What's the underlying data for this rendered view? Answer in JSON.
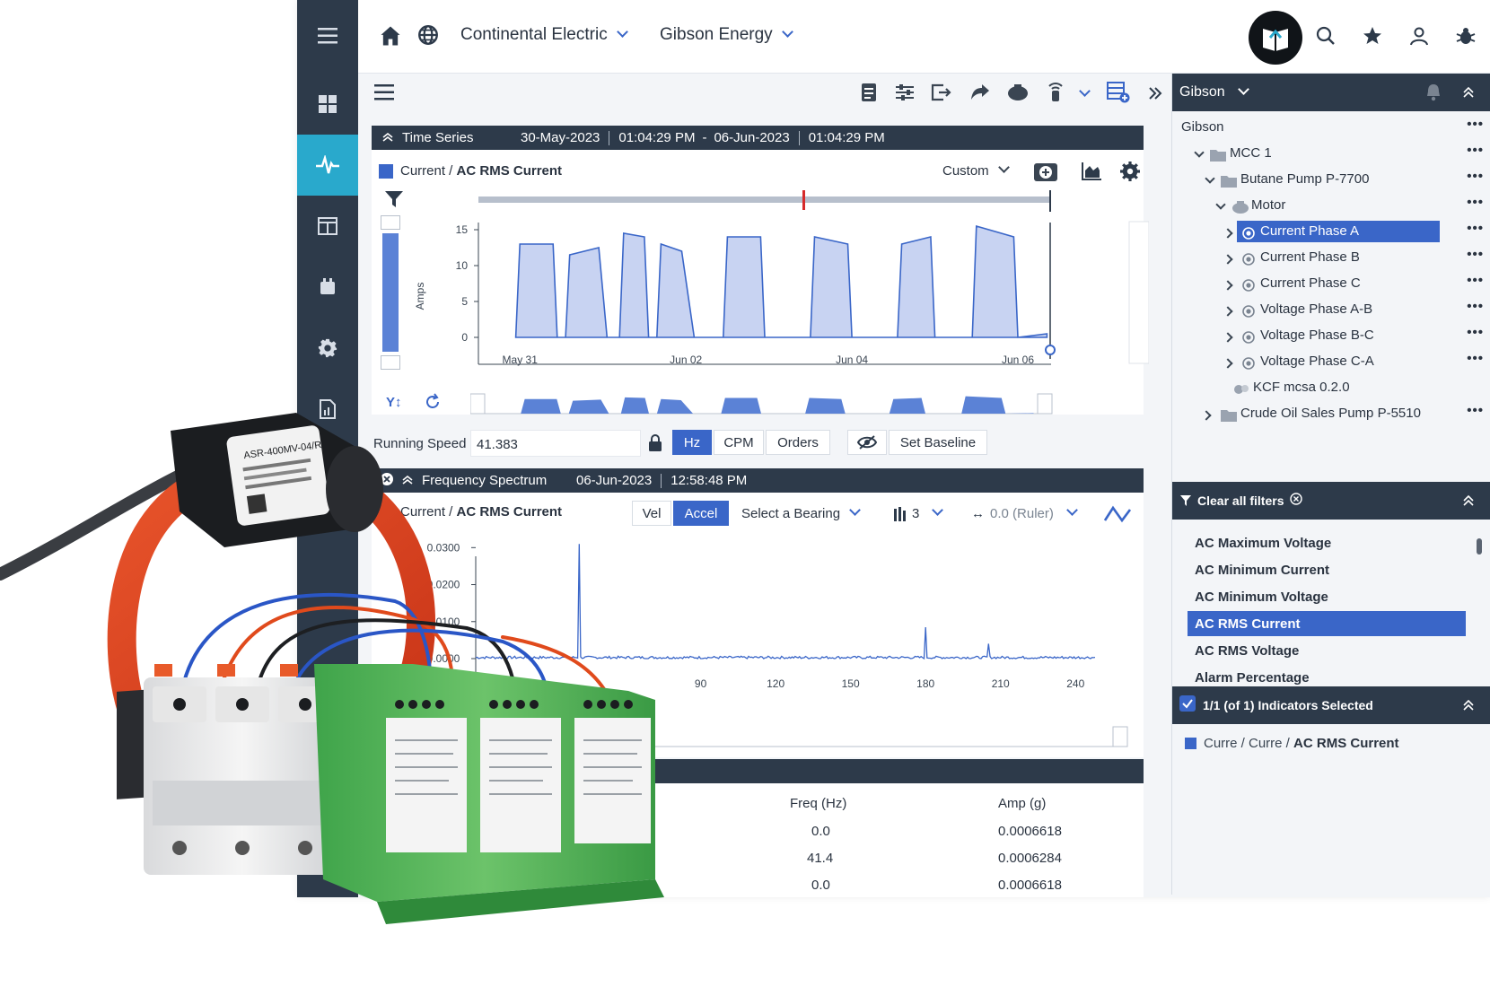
{
  "colors": {
    "rail": "#2d3a4a",
    "rail_active": "#29a9cc",
    "accent": "#3a66c8",
    "header": "#2d3a4a",
    "series_fill": "#c8d3f2",
    "series_stroke": "#3a66c8",
    "red_marker": "#d62b2b"
  },
  "topbar": {
    "breadcrumb_1": "Continental Electric",
    "breadcrumb_2": "Gibson Energy"
  },
  "timeseries": {
    "header_title": "Time Series",
    "start_date": "30-May-2023",
    "start_time": "01:04:29 PM",
    "dash": "-",
    "end_date": "06-Jun-2023",
    "end_time": "01:04:29 PM",
    "series_prefix": "Current / ",
    "series_name": "AC RMS Current",
    "range_select": "Custom",
    "ylabel": "Amps",
    "yticks": [
      "15",
      "10",
      "5",
      "0"
    ],
    "xticks": [
      "May 31",
      "Jun 02",
      "Jun 04",
      "Jun 06"
    ]
  },
  "chart_data": [
    {
      "type": "area",
      "ylabel": "Amps",
      "x_ticks": [
        "May 31",
        "Jun 02",
        "Jun 04",
        "Jun 06"
      ],
      "ylim": [
        0,
        16
      ],
      "series": [
        {
          "name": "AC RMS Current",
          "values_description_free": [
            [
              30.95,
              0
            ],
            [
              31.0,
              13
            ],
            [
              31.4,
              13
            ],
            [
              31.45,
              0
            ],
            [
              31.55,
              0
            ],
            [
              31.6,
              11.5
            ],
            [
              31.95,
              12.5
            ],
            [
              32.05,
              0
            ],
            [
              32.2,
              0
            ],
            [
              32.25,
              14.5
            ],
            [
              32.5,
              14
            ],
            [
              32.55,
              0
            ],
            [
              32.65,
              0
            ],
            [
              32.7,
              13
            ],
            [
              32.95,
              12
            ],
            [
              33.1,
              0
            ],
            [
              33.45,
              0
            ],
            [
              33.5,
              14
            ],
            [
              33.9,
              14
            ],
            [
              33.95,
              0
            ],
            [
              34.5,
              0
            ],
            [
              34.55,
              14
            ],
            [
              34.95,
              13
            ],
            [
              35.0,
              0
            ],
            [
              35.55,
              0
            ],
            [
              35.6,
              13
            ],
            [
              35.95,
              14
            ],
            [
              36.0,
              0
            ],
            [
              36.45,
              0
            ],
            [
              36.5,
              15.5
            ],
            [
              36.95,
              14
            ],
            [
              37.0,
              0
            ],
            [
              37.35,
              0.5
            ]
          ]
        }
      ]
    },
    {
      "type": "line",
      "ylabel": "",
      "xlabel": "",
      "x_ticks": [
        "90",
        "120",
        "150",
        "180",
        "210",
        "240"
      ],
      "y_ticks": [
        "0.0300",
        "0.0200",
        "0.0100",
        "0.0000"
      ],
      "ylim": [
        0,
        0.0325
      ],
      "xlim": [
        0,
        250
      ],
      "series": [
        {
          "name": "AC RMS Current",
          "peaks": [
            {
              "x": 41.4,
              "y": 0.031
            },
            {
              "x": 180,
              "y": 0.0085
            },
            {
              "x": 205,
              "y": 0.004
            }
          ],
          "baseline": 0.0003
        }
      ]
    }
  ],
  "controls": {
    "running_speed_label": "Running Speed",
    "running_speed_value": "41.383",
    "hz": "Hz",
    "cpm": "CPM",
    "orders": "Orders",
    "set_baseline": "Set Baseline"
  },
  "spectrum": {
    "header_title": "Frequency Spectrum",
    "date": "06-Jun-2023",
    "time": "12:58:48 PM",
    "series_prefix": "Current / ",
    "series_name": "AC RMS Current",
    "vel": "Vel",
    "accel": "Accel",
    "bearing": "Select a Bearing",
    "harmonics": "3",
    "ruler": "0.0 (Ruler)",
    "yticks": [
      "0.0300",
      "0.0200",
      "0.0100",
      "0.0000"
    ],
    "xticks": [
      "90",
      "120",
      "150",
      "180",
      "210",
      "240"
    ]
  },
  "table": {
    "headers": [
      "Freq (Hz)",
      "Amp (g)"
    ],
    "rows": [
      [
        "0.0",
        "0.0006618"
      ],
      [
        "41.4",
        "0.0006284"
      ],
      [
        "0.0",
        "0.0006618"
      ]
    ]
  },
  "right_panel": {
    "site": "Gibson",
    "tree": [
      {
        "label": "Gibson",
        "level": 0
      },
      {
        "label": "MCC 1",
        "level": 1
      },
      {
        "label": "Butane Pump P-7700",
        "level": 2
      },
      {
        "label": "Motor",
        "level": 3
      },
      {
        "label": "Current Phase A",
        "level": 4,
        "selected": true
      },
      {
        "label": "Current Phase B",
        "level": 4
      },
      {
        "label": "Current Phase C",
        "level": 4
      },
      {
        "label": "Voltage Phase A-B",
        "level": 4
      },
      {
        "label": "Voltage Phase B-C",
        "level": 4
      },
      {
        "label": "Voltage Phase C-A",
        "level": 4
      },
      {
        "label": "KCF mcsa 0.2.0",
        "level": 5
      },
      {
        "label": "Crude Oil Sales Pump P-5510",
        "level": 2
      }
    ],
    "clear_filters": "Clear all filters",
    "filters": [
      "AC Maximum Voltage",
      "AC Minimum Current",
      "AC Minimum Voltage",
      "AC RMS Current",
      "AC RMS Voltage",
      "Alarm Percentage"
    ],
    "selected_filter_index": 3,
    "indicators_selected": "1/1 (of 1) Indicators Selected",
    "indicator_prefix": "Curre / Curre / ",
    "indicator_name": "AC RMS Current"
  },
  "product_photo": {
    "sensor_label": "ASR-400MV-04/R"
  }
}
